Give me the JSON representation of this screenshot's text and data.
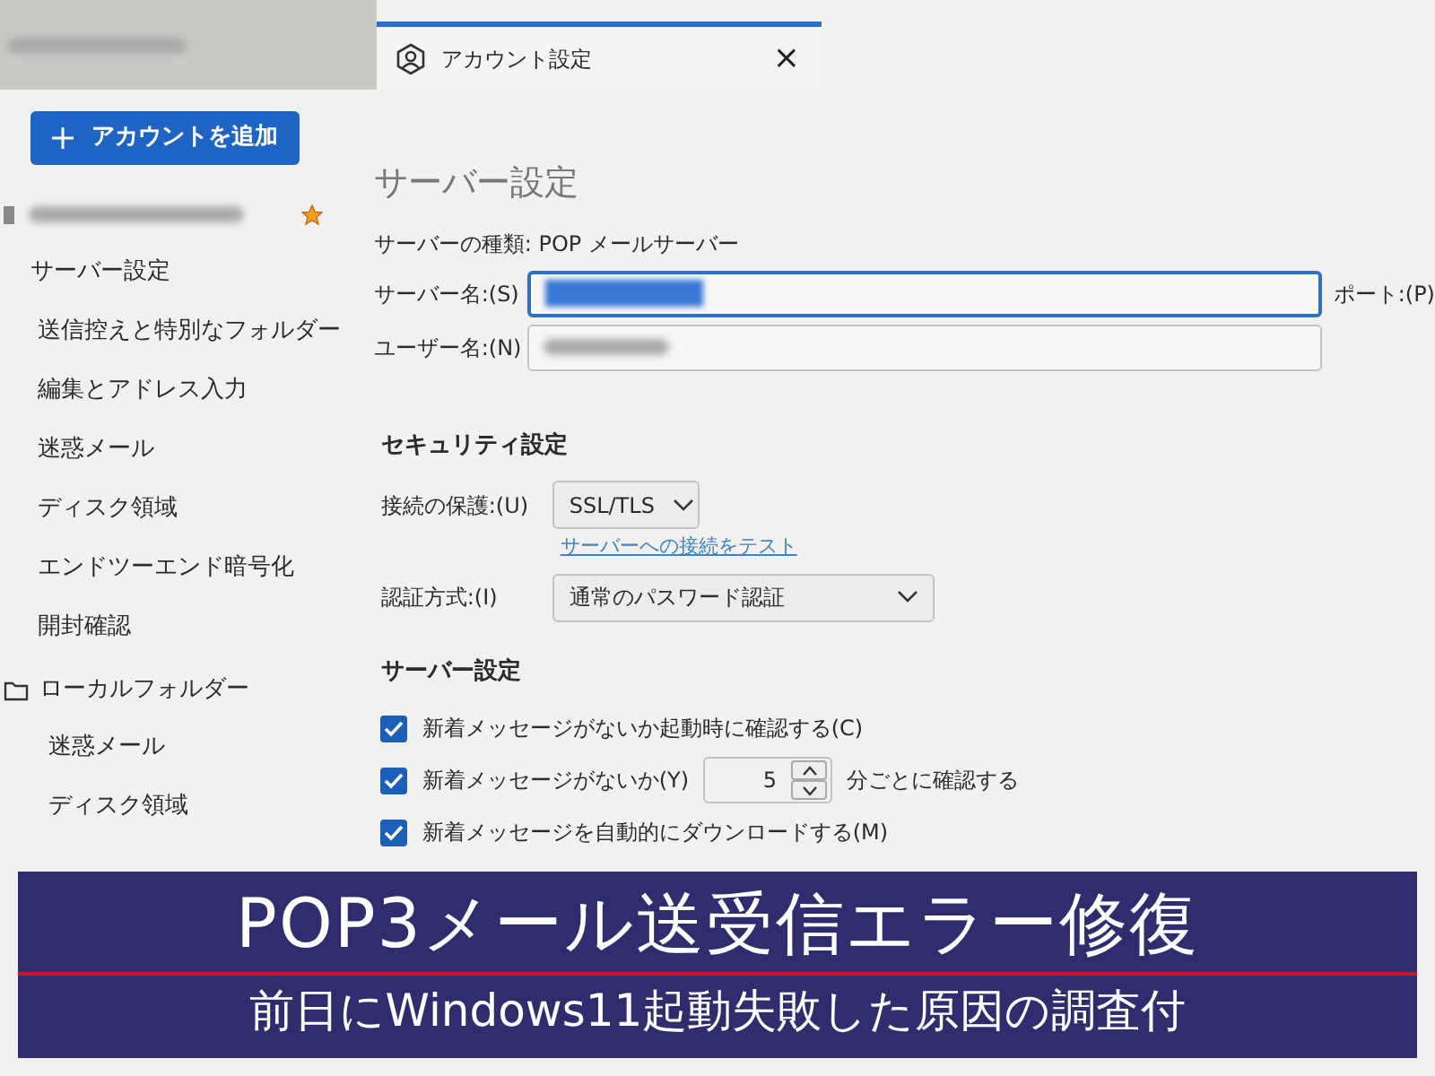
{
  "tabs": [
    {
      "kind": "blurred",
      "selected": false
    },
    {
      "kind": "account",
      "label": "アカウント設定",
      "selected": true,
      "close_label": "×"
    }
  ],
  "sidebar": {
    "add_button": "アカウントを追加",
    "tree": [
      {
        "kind": "account",
        "starred": true,
        "children": [
          {
            "label": "サーバー設定"
          },
          {
            "label": "送信控えと特別なフォルダー"
          },
          {
            "label": "編集とアドレス入力"
          },
          {
            "label": "迷惑メール"
          },
          {
            "label": "ディスク領域"
          },
          {
            "label": "エンドツーエンド暗号化"
          },
          {
            "label": "開封確認"
          }
        ]
      },
      {
        "kind": "folder",
        "label": "ローカルフォルダー",
        "children": [
          {
            "label": "迷惑メール"
          },
          {
            "label": "ディスク領域"
          }
        ]
      }
    ]
  },
  "page": {
    "title": "サーバー設定",
    "server_type": "サーバーの種類: POP メールサーバー",
    "server_name": {
      "label": "サーバー名:(S)",
      "focused": true,
      "highlighted": true,
      "trailing_label": "ポート:(P)"
    },
    "user_name": {
      "label": "ユーザー名:(N)",
      "focused": false,
      "highlighted": false
    },
    "security": {
      "heading": "セキュリティ設定",
      "connection": {
        "label": "接続の保護:(U)",
        "value": "SSL/TLS"
      },
      "test_link": "サーバーへの接続をテスト",
      "auth": {
        "label": "認証方式:(I)",
        "value": "通常のパスワード認証"
      }
    },
    "server_settings": {
      "heading": "サーバー設定",
      "options": [
        {
          "kind": "check",
          "label": "新着メッセージがないか起動時に確認する(C)",
          "checked": true
        },
        {
          "kind": "interval",
          "label": "新着メッセージがないか(Y)",
          "checked": true,
          "value": "5",
          "suffix": "分ごとに確認する"
        },
        {
          "kind": "check",
          "label": "新着メッセージを自動的にダウンロードする(M)",
          "checked": true
        }
      ]
    }
  },
  "banner": {
    "title": "POP3メール送受信エラー修復",
    "subtitle": "前日にWindows11起動失敗した原因の調査付"
  }
}
